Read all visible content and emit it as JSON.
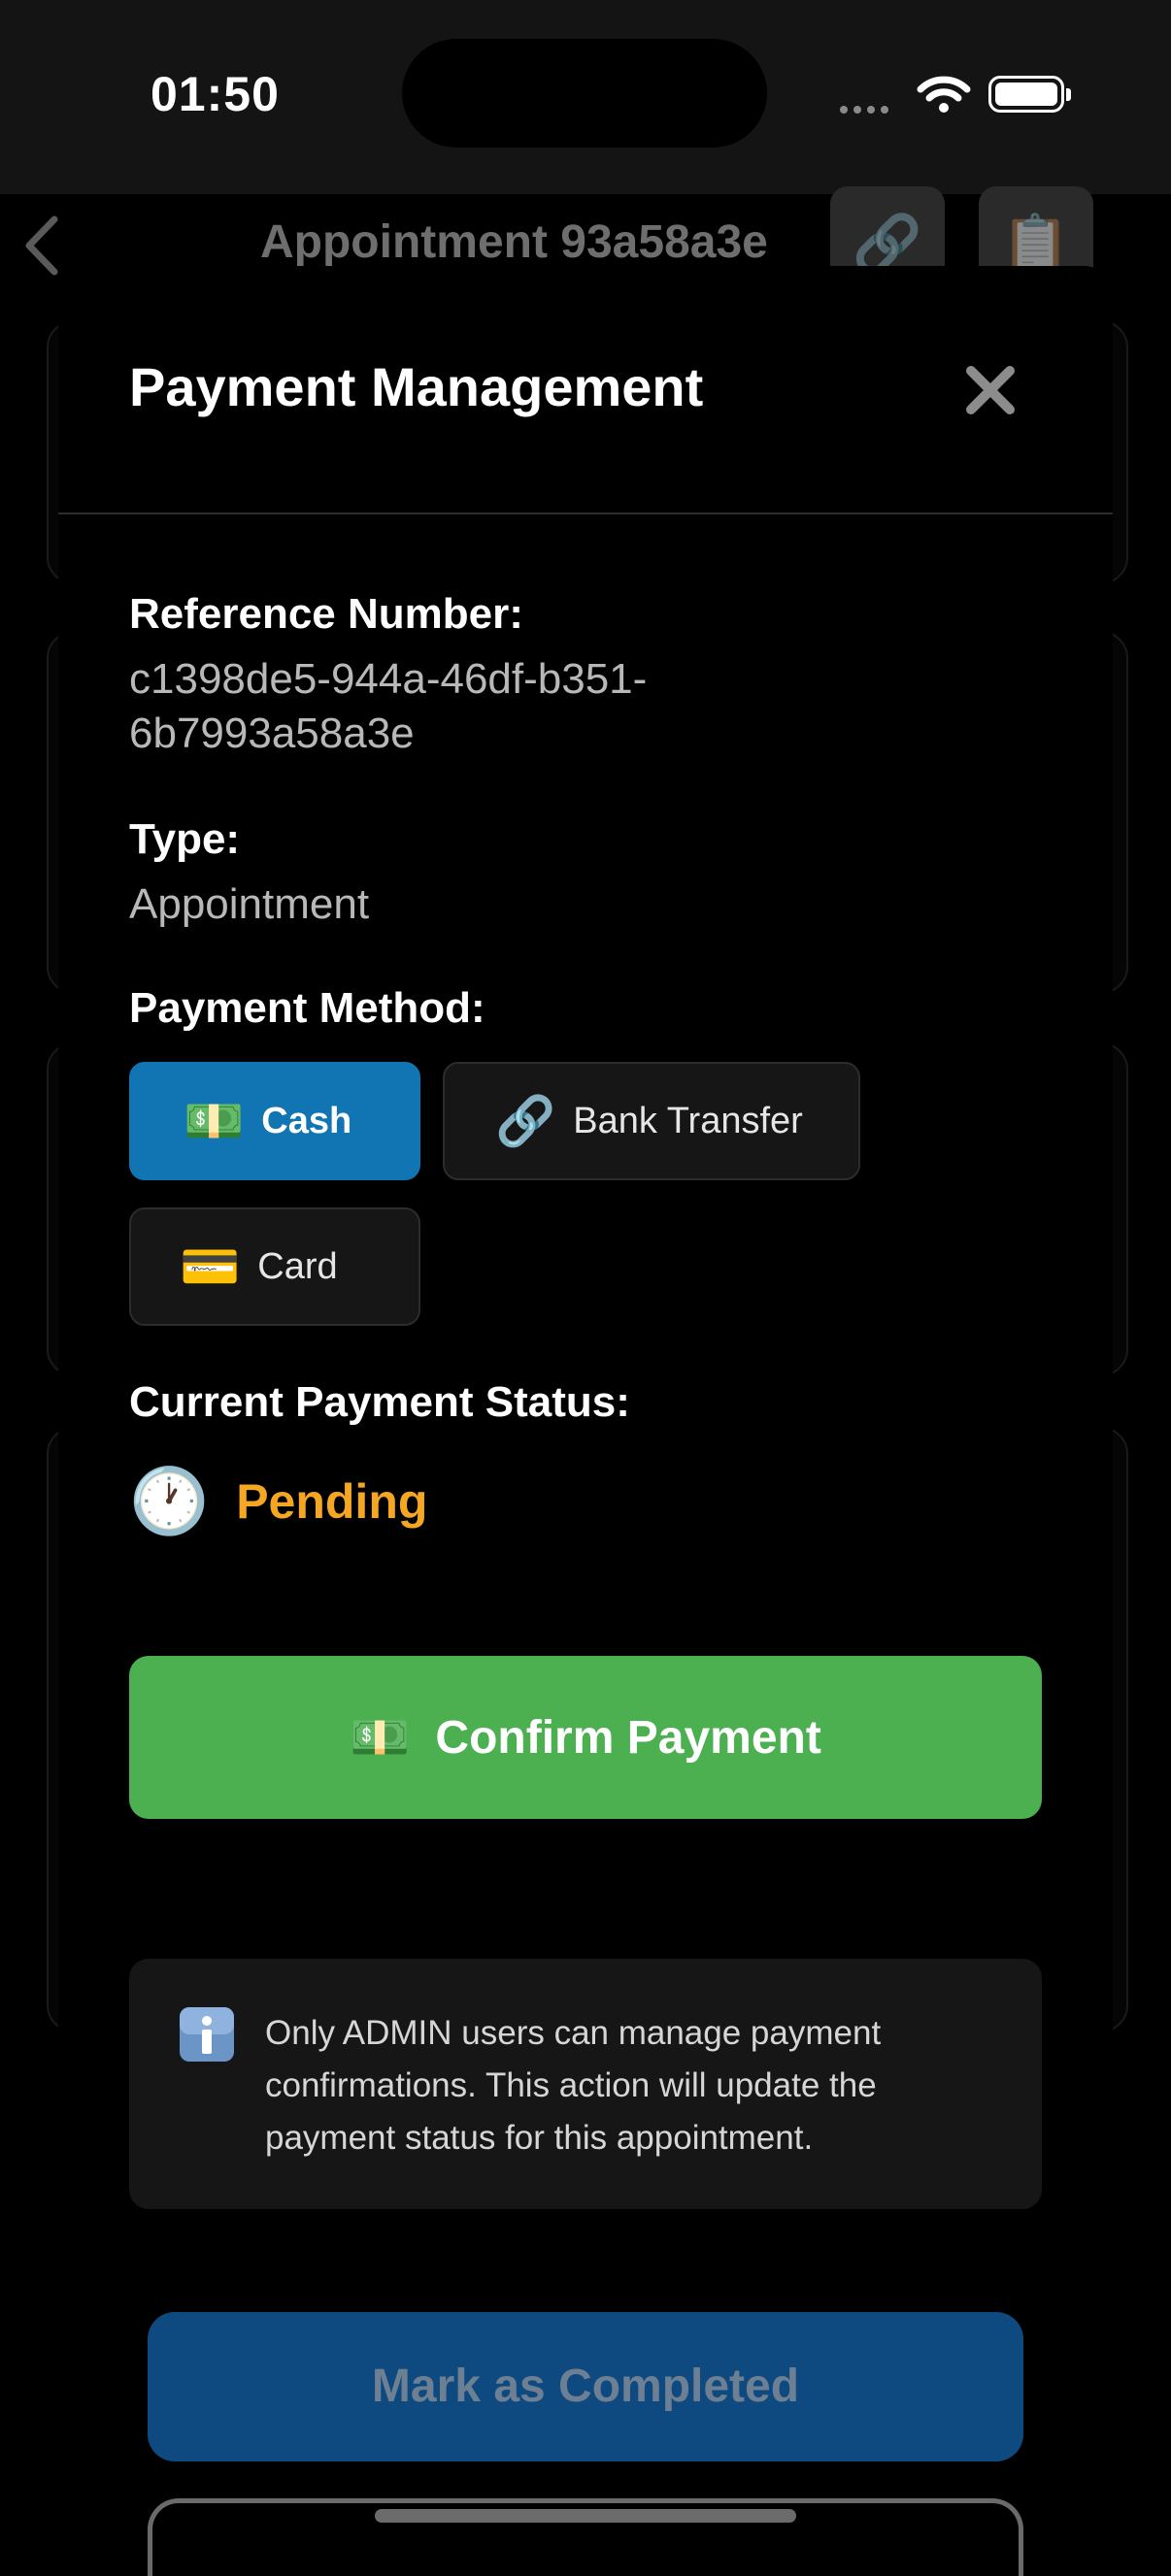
{
  "status_bar": {
    "time": "01:50"
  },
  "navbar": {
    "title": "Appointment 93a58a3e",
    "back_icon": "chevron-left-icon",
    "link_icon": "link-icon",
    "clipboard_icon": "clipboard-icon"
  },
  "modal": {
    "title": "Payment Management",
    "close_icon": "close-icon",
    "reference_label": "Reference Number:",
    "reference_value": "c1398de5-944a-46df-b351-6b7993a58a3e",
    "type_label": "Type:",
    "type_value": "Appointment",
    "method_label": "Payment Method:",
    "methods": [
      {
        "label": "Cash",
        "icon": "💵",
        "selected": true
      },
      {
        "label": "Bank Transfer",
        "icon": "🔗",
        "selected": false
      },
      {
        "label": "Card",
        "icon": "💳",
        "selected": false
      }
    ],
    "status_label": "Current Payment Status:",
    "status_icon": "🕐",
    "status_value": "Pending",
    "confirm_icon": "💵",
    "confirm_label": "Confirm Payment",
    "info_icon": "info-icon",
    "info_text": "Only ADMIN users can manage payment confirmations. This action will update the payment status for this appointment."
  },
  "background": {
    "primary_button": "Mark as Completed"
  },
  "colors": {
    "accent_blue": "#1174b3",
    "confirm_green": "#4caf50",
    "pending_orange": "#f5a623",
    "background": "#000000"
  }
}
